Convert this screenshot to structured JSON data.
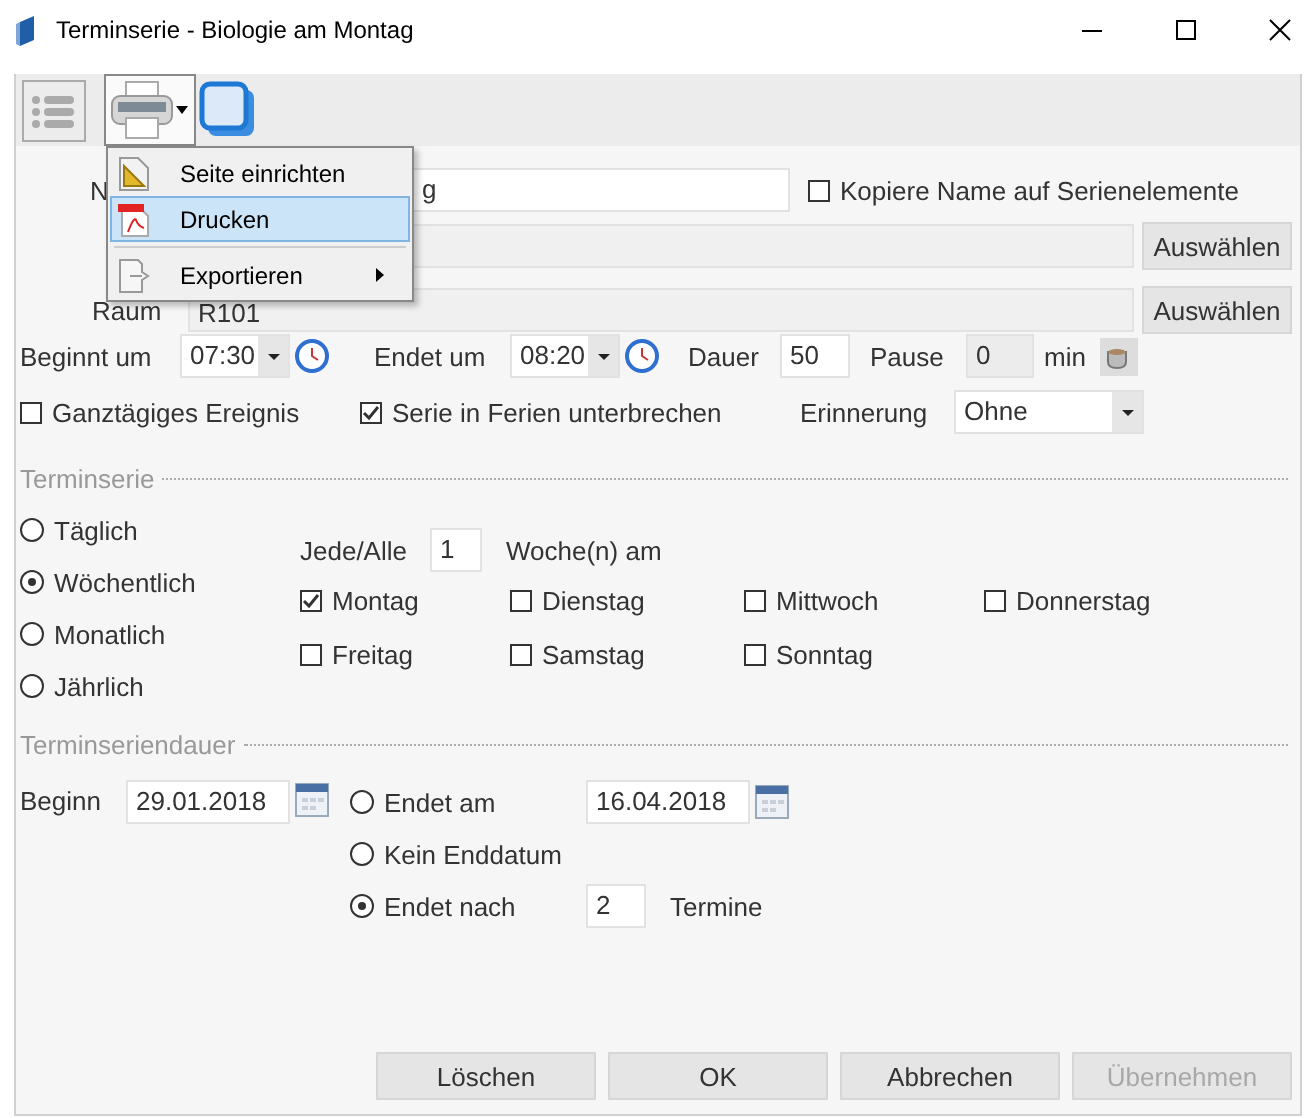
{
  "window": {
    "title": "Terminserie - Biologie am Montag"
  },
  "print_menu": {
    "expanded": true,
    "items": [
      {
        "label": "Seite einrichten",
        "kind": "setup",
        "selected": false
      },
      {
        "label": "Drucken",
        "kind": "pdf",
        "selected": true
      },
      {
        "label": "Exportieren",
        "kind": "submenu",
        "selected": false
      }
    ]
  },
  "form": {
    "name_label": "N",
    "name_value": "g",
    "copy_name": {
      "label": "Kopiere Name auf Serienelemente",
      "checked": false
    },
    "row2_button": "Auswählen",
    "room_label": "Raum",
    "room_value": "R101",
    "room_button": "Auswählen",
    "start_label": "Beginnt um",
    "start_time": "07:30",
    "end_label": "Endet um",
    "end_time": "08:20",
    "duration_label": "Dauer",
    "duration": "50",
    "pause_label": "Pause",
    "pause": "0",
    "pause_unit": "min",
    "all_day": {
      "label": "Ganztägiges Ereignis",
      "checked": false
    },
    "holiday_break": {
      "label": "Serie in Ferien unterbrechen",
      "checked": true
    },
    "reminder_label": "Erinnerung",
    "reminder": "Ohne"
  },
  "recurrence": {
    "title": "Terminserie",
    "patterns": [
      {
        "label": "Täglich",
        "selected": false
      },
      {
        "label": "Wöchentlich",
        "selected": true
      },
      {
        "label": "Monatlich",
        "selected": false
      },
      {
        "label": "Jährlich",
        "selected": false
      }
    ],
    "every_label": "Jede/Alle",
    "every": "1",
    "every_unit": "Woche(n) am",
    "days": [
      {
        "label": "Montag",
        "checked": true
      },
      {
        "label": "Dienstag",
        "checked": false
      },
      {
        "label": "Mittwoch",
        "checked": false
      },
      {
        "label": "Donnerstag",
        "checked": false
      },
      {
        "label": "Freitag",
        "checked": false
      },
      {
        "label": "Samstag",
        "checked": false
      },
      {
        "label": "Sonntag",
        "checked": false
      }
    ]
  },
  "range": {
    "title": "Terminseriendauer",
    "start_label": "Beginn",
    "start_date": "29.01.2018",
    "end_options": [
      {
        "label": "Endet am",
        "selected": false,
        "kind": "date",
        "value": "16.04.2018"
      },
      {
        "label": "Kein Enddatum",
        "selected": false,
        "kind": "none"
      },
      {
        "label": "Endet nach",
        "selected": true,
        "kind": "count",
        "value": "2",
        "unit": "Termine"
      }
    ]
  },
  "buttons": [
    {
      "label": "Löschen",
      "disabled": false
    },
    {
      "label": "OK",
      "disabled": false
    },
    {
      "label": "Abbrechen",
      "disabled": false
    },
    {
      "label": "Übernehmen",
      "disabled": true
    }
  ]
}
